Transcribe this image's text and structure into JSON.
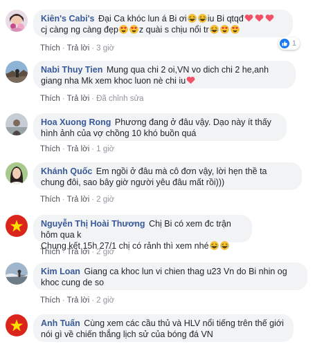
{
  "action_labels": {
    "like": "Thích",
    "reply": "Trả lời",
    "edited": "Đã chỉnh sửa"
  },
  "comments": [
    {
      "author": "Kiên's Cabi's",
      "text_parts": [
        "Đại Ca khóc lun á Bi ơi",
        "iu Bi qtqđ",
        "cj càng ng càng đẹp",
        "z quài s chịu nổi tr"
      ],
      "time": "3 giờ",
      "reaction_count": "1"
    },
    {
      "author": "Nabi Thuy Tien",
      "text_parts": [
        "Mung qua chi 2 oi,VN vo dich chi 2 he,anh",
        "giang nha Mk xem khoc luon nè chi iu"
      ],
      "time": "",
      "edited": true
    },
    {
      "author": "Hoa Xuong Rong",
      "text_parts": [
        "Phương đang ở đâu vậy. Dạo này ít thấy",
        "hình ảnh của vợ chồng 10 khó buồn quá"
      ],
      "time": "1 giờ"
    },
    {
      "author": "Khánh Quốc",
      "text_parts": [
        "Em ngồi ở đâu mà cô đơn vậy, lời hẹn thề ta",
        "chung đôi, sao bây giờ người yêu đâu mất rồi)))"
      ],
      "time": "2 giờ"
    },
    {
      "author": "Nguyễn Thị Hoài Thương",
      "text_parts": [
        "Chị Bi có xem đc trận hôm qua k",
        "Chung kết 15h 27/1 chị có rảnh thì xem nhé"
      ],
      "time": "2 giờ"
    },
    {
      "author": "Kim Loan",
      "text_parts": [
        "Giang ca khoc lun vi chien thag u23 Vn do Bi nhin og",
        "khoc cung de so"
      ],
      "time": "2 giờ"
    },
    {
      "author": "Anh Tuấn",
      "text_parts": [
        "Cùng xem các cầu thủ và HLV nổi tiếng trên thế giới",
        "nói gì về chiến thắng lịch sử của bóng đá VN"
      ],
      "time": ""
    }
  ],
  "colors": {
    "author": "#385898",
    "bubble": "#f2f3f5",
    "meta": "#90949c",
    "like_blue": "#1877f2",
    "heart": "#f25268"
  }
}
